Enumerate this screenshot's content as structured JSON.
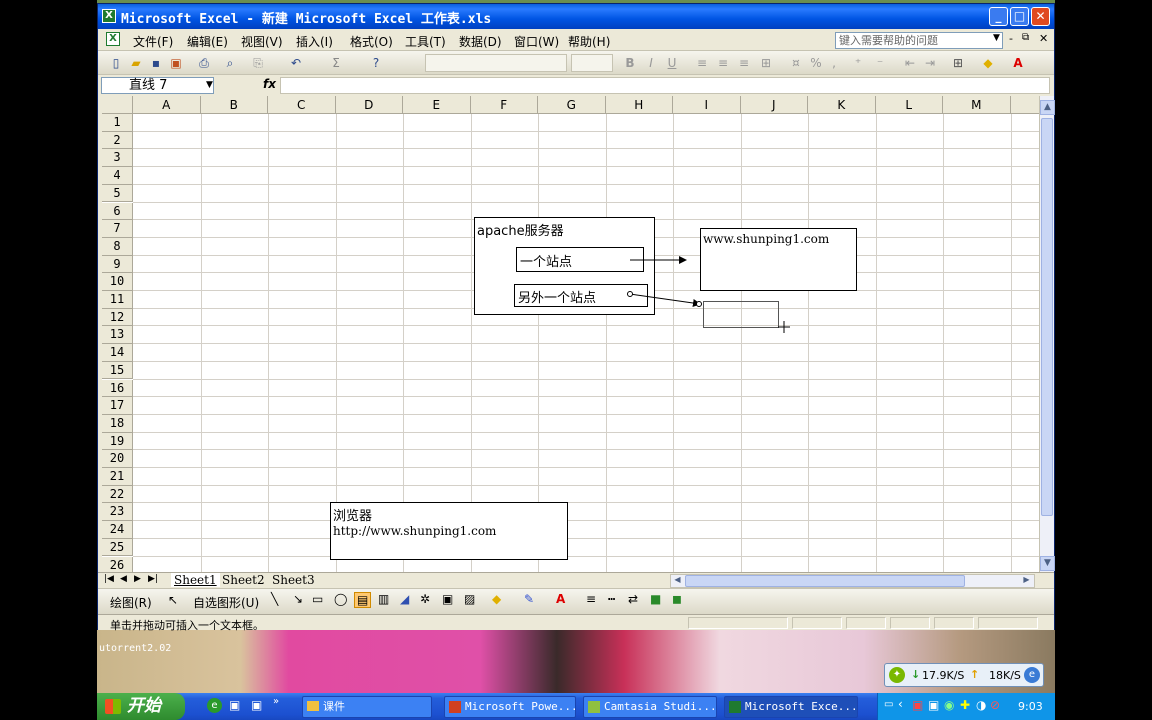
{
  "window": {
    "title": "Microsoft Excel - 新建 Microsoft Excel 工作表.xls"
  },
  "menu": {
    "items": [
      "文件(F)",
      "编辑(E)",
      "视图(V)",
      "插入(I)",
      "格式(O)",
      "工具(T)",
      "数据(D)",
      "窗口(W)",
      "帮助(H)"
    ],
    "help_placeholder": "键入需要帮助的问题"
  },
  "formula_bar": {
    "name_box": "直线 7",
    "fx": "fx"
  },
  "grid": {
    "columns": [
      "A",
      "B",
      "C",
      "D",
      "E",
      "F",
      "G",
      "H",
      "I",
      "J",
      "K",
      "L",
      "M"
    ],
    "rows": [
      "1",
      "2",
      "3",
      "4",
      "5",
      "6",
      "7",
      "8",
      "9",
      "10",
      "11",
      "12",
      "13",
      "14",
      "15",
      "16",
      "17",
      "18",
      "19",
      "20",
      "21",
      "22",
      "23",
      "24",
      "25",
      "26"
    ]
  },
  "shapes": {
    "apache_box": "apache服务器",
    "site1": "一个站点",
    "site2": "另外一个站点",
    "www_box": "www.shunping1.com",
    "browser_title": "浏览器",
    "browser_url": "http://www.shunping1.com"
  },
  "sheets": [
    "Sheet1",
    "Sheet2",
    "Sheet3"
  ],
  "drawbar": {
    "draw": "绘图(R)",
    "autoshape": "自选图形(U)"
  },
  "status": {
    "text": "单击并拖动可插入一个文本框。"
  },
  "desktop": {
    "torrent_label": "utorrent2.02",
    "net_down": "17.9K/S",
    "net_up": "18K/S"
  },
  "taskbar": {
    "start": "开始",
    "tasks": [
      "课件",
      "Microsoft Powe...",
      "Camtasia Studi...",
      "Microsoft Exce..."
    ],
    "clock": "9:03"
  },
  "colors": {
    "title_blue": "#0054e3",
    "taskbar_blue": "#245edb",
    "start_green": "#2e8b2e",
    "excel_green": "#1f7a2f"
  }
}
